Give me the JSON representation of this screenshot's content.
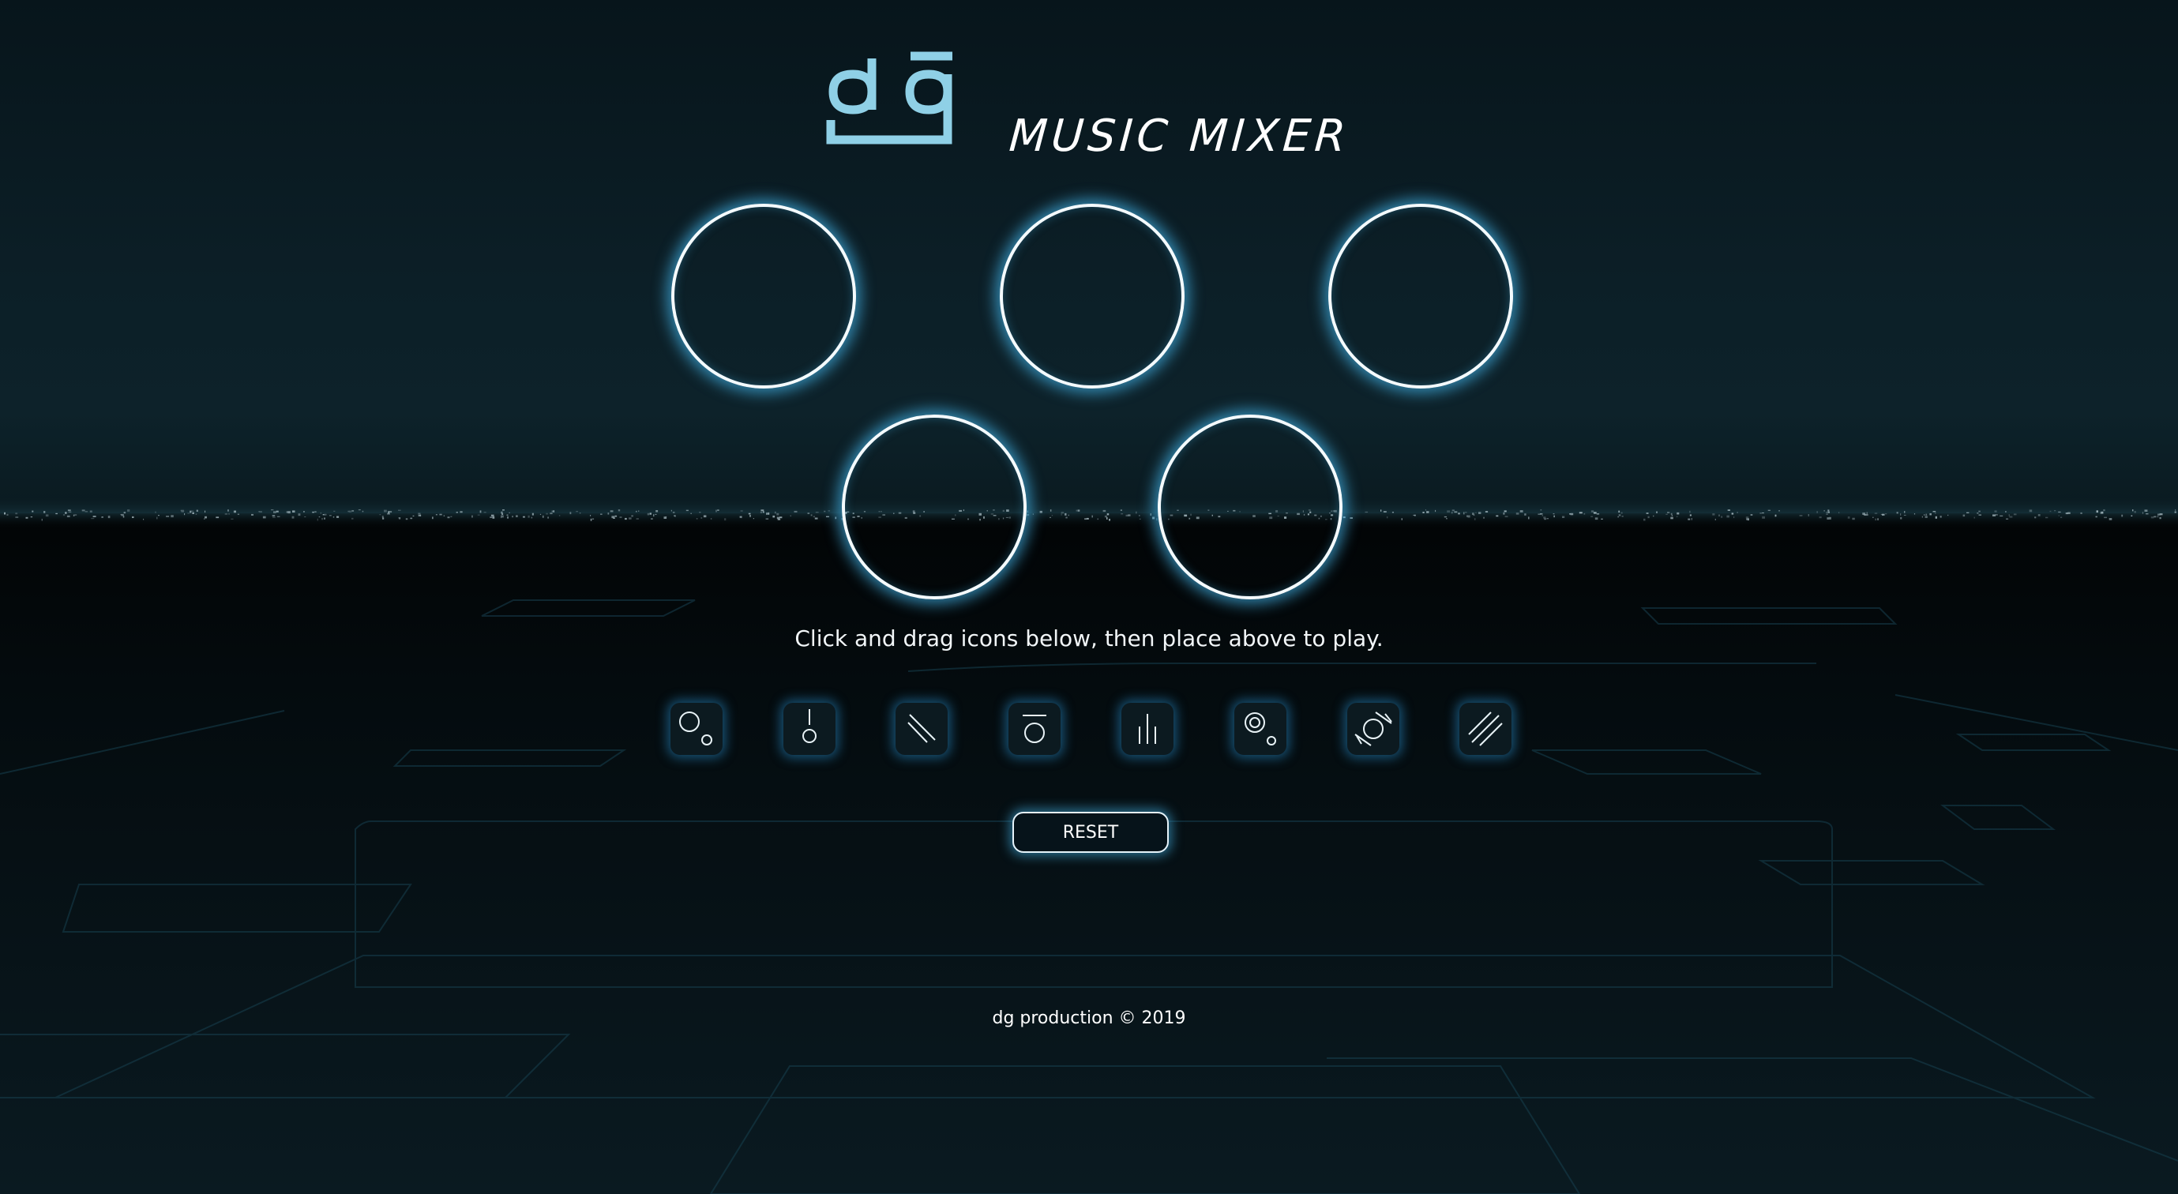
{
  "header": {
    "logo_text": "dg",
    "title": "MUSIC MIXER"
  },
  "slots": [
    {
      "name": "slot-1"
    },
    {
      "name": "slot-2"
    },
    {
      "name": "slot-3"
    },
    {
      "name": "slot-4"
    },
    {
      "name": "slot-5"
    }
  ],
  "instructions": "Click and drag icons below, then place above to play.",
  "icons": [
    "circles-icon",
    "pin-circle-icon",
    "double-slash-icon",
    "bar-circle-icon",
    "bars-icon",
    "target-dot-icon",
    "rotated-circle-icon",
    "triple-slash-icon"
  ],
  "reset_label": "RESET",
  "footer": "dg production © 2019",
  "colors": {
    "glow": "#3fa8da",
    "logo": "#8fd0e6",
    "background": "#03090c"
  }
}
